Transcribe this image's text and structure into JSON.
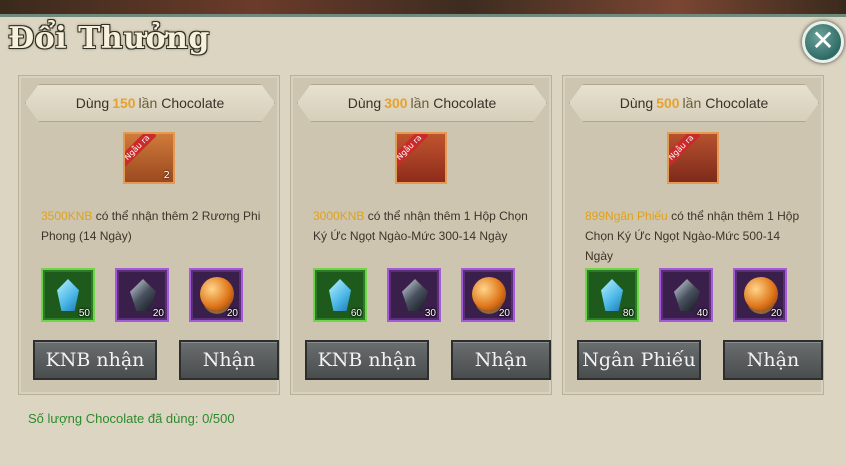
{
  "header": {
    "title": "Đổi Thưởng",
    "close_label": "✕"
  },
  "cards": [
    {
      "head": {
        "prefix": "Dùng",
        "count": "150",
        "lan": "lần",
        "suffix": "Chocolate"
      },
      "chest": {
        "badge": "Ngẫu ra",
        "count": "2",
        "icon": "treasure-chest-icon"
      },
      "desc": {
        "highlight": "3500KNB",
        "text": " có thể nhận thêm 2 Rương Phi Phong (14 Ngày)"
      },
      "items": [
        {
          "icon": "blue-crystal-icon",
          "qty": "50",
          "rarity": "green"
        },
        {
          "icon": "dark-crystal-icon",
          "qty": "20",
          "rarity": "purple"
        },
        {
          "icon": "orange-orb-icon",
          "qty": "20",
          "rarity": "purple"
        }
      ],
      "buttons": {
        "left": "KNB nhận",
        "right": "Nhận"
      }
    },
    {
      "head": {
        "prefix": "Dùng",
        "count": "300",
        "lan": "lần",
        "suffix": "Chocolate"
      },
      "chest": {
        "badge": "Ngẫu ra",
        "count": "",
        "icon": "gift-box-icon"
      },
      "desc": {
        "highlight": "3000KNB",
        "text": " có thể nhận thêm 1 Hộp Chọn Ký Ức Ngọt Ngào-Mức 300-14 Ngày"
      },
      "items": [
        {
          "icon": "blue-crystal-icon",
          "qty": "60",
          "rarity": "green"
        },
        {
          "icon": "dark-crystal-icon",
          "qty": "30",
          "rarity": "purple"
        },
        {
          "icon": "orange-orb-icon",
          "qty": "20",
          "rarity": "purple"
        }
      ],
      "buttons": {
        "left": "KNB nhận",
        "right": "Nhận"
      }
    },
    {
      "head": {
        "prefix": "Dùng",
        "count": "500",
        "lan": "lần",
        "suffix": "Chocolate"
      },
      "chest": {
        "badge": "Ngẫu ra",
        "count": "",
        "icon": "gift-box-icon"
      },
      "desc": {
        "highlight": "899Ngân Phiếu",
        "text": " có thể nhận thêm 1 Hộp Chọn Ký Ức Ngọt Ngào-Mức 500-14 Ngày"
      },
      "items": [
        {
          "icon": "blue-crystal-icon",
          "qty": "80",
          "rarity": "green"
        },
        {
          "icon": "dark-crystal-icon",
          "qty": "40",
          "rarity": "purple"
        },
        {
          "icon": "orange-orb-icon",
          "qty": "20",
          "rarity": "purple"
        }
      ],
      "buttons": {
        "left": "Ngân Phiếu",
        "right": "Nhận"
      }
    }
  ],
  "footer": {
    "text": "Số lượng Chocolate đã dùng: 0/500"
  },
  "colors": {
    "panel": "#dcd5c1",
    "highlight": "#e8a12a",
    "footer": "#2e8a2e",
    "button": "#5a5d5d"
  }
}
